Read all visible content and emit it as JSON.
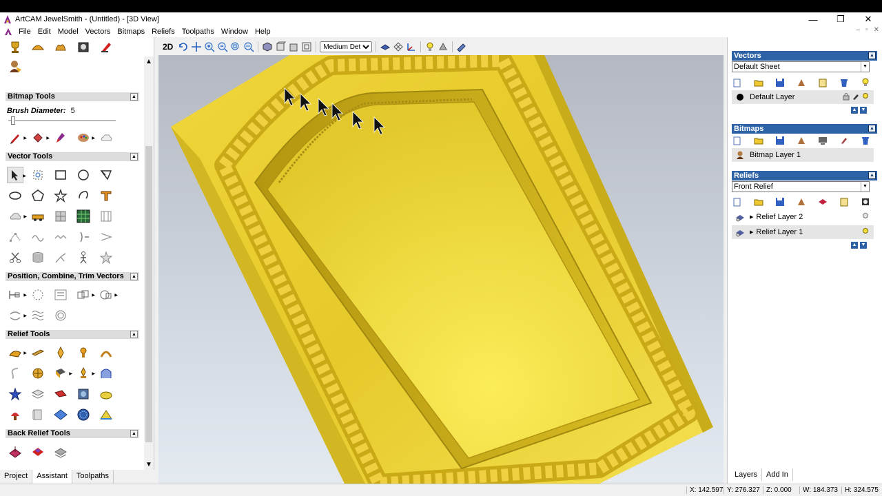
{
  "window": {
    "title": "ArtCAM JewelSmith - (Untitled) - [3D View]",
    "min": "—",
    "max": "❐",
    "close": "✕"
  },
  "menu": [
    "File",
    "Edit",
    "Model",
    "Vectors",
    "Bitmaps",
    "Reliefs",
    "Toolpaths",
    "Window",
    "Help"
  ],
  "mdi_controls": {
    "min": "–",
    "restore": "▫",
    "close": "✕"
  },
  "left_panel": {
    "bitmap_tools": {
      "title": "Bitmap Tools",
      "brush_label": "Brush Diameter:",
      "brush_value": "5"
    },
    "vector_tools": {
      "title": "Vector Tools"
    },
    "position_tools": {
      "title": "Position, Combine, Trim Vectors"
    },
    "relief_tools": {
      "title": "Relief Tools"
    },
    "back_relief_tools": {
      "title": "Back Relief Tools"
    },
    "tabs": [
      "Project",
      "Assistant",
      "Toolpaths"
    ],
    "active_tab": "Assistant"
  },
  "view_toolbar": {
    "mode_label": "2D",
    "detail_select": "Medium Detail"
  },
  "right_panel": {
    "vectors": {
      "title": "Vectors",
      "sheet": "Default Sheet",
      "layers": [
        {
          "name": "Default Layer"
        }
      ]
    },
    "bitmaps": {
      "title": "Bitmaps",
      "layers": [
        {
          "name": "Bitmap Layer 1"
        }
      ]
    },
    "reliefs": {
      "title": "Reliefs",
      "selected": "Front Relief",
      "layers": [
        {
          "name": "Relief Layer 2"
        },
        {
          "name": "Relief Layer 1"
        }
      ]
    },
    "tabs": [
      "Layers",
      "Add In"
    ],
    "active_tab": "Layers"
  },
  "status": {
    "x": "X: 142.597",
    "y": "Y: 276.327",
    "z": "Z: 0.000",
    "w": "W: 184.373",
    "h": "H: 324.575"
  },
  "colors": {
    "relief_gold": "#e8cd2a",
    "panel_header": "#2d62a6"
  }
}
